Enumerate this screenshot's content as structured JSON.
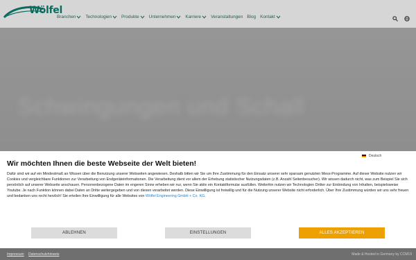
{
  "header": {
    "logo_text": "Wölfel",
    "nav": [
      {
        "label": "Branchen",
        "dropdown": true
      },
      {
        "label": "Technologien",
        "dropdown": true
      },
      {
        "label": "Produkte",
        "dropdown": true
      },
      {
        "label": "Unternehmen",
        "dropdown": true
      },
      {
        "label": "Karriere",
        "dropdown": true
      },
      {
        "label": "Veranstaltungen",
        "dropdown": false
      },
      {
        "label": "Blog",
        "dropdown": false
      },
      {
        "label": "Kontakt",
        "dropdown": true
      }
    ],
    "icons": [
      "search-icon",
      "globe-icon"
    ],
    "brand_color": "#0a6c5e"
  },
  "hero": {
    "blurred_text": "Schwingungen und Schall"
  },
  "consent": {
    "language": "Deutsch",
    "title": "Wir möchten Ihnen die beste Webseite der Welt bieten!",
    "body": "Dafür sind wir auf ein Mindestmaß an Wissen über die Benutzung unserer Webseiten angewiesen. Deshalb bitten wir Sie um Ihre Zustimmung für den Einsatz unserer sehr sparsam genutzten Mess-Programme. Auf dieser Website nutzen wir Cookies und vergleichbare Funktionen zur Verarbeitung von Endgeräteinformationen. Die Verarbeitung dient vor allem der Erhebung statistischer Nutzungsdaten (z.B. Anzahl Seitenbesucher). Wir wissen dadurch nicht, was zum Beispiel Sie sich persönlich auf unserer Webseite anschauen. Personenbezogene Daten im engeren Sinne erheben wir nur, wenn Sie aktiv ein Kontaktformular ausfüllen. Weiterhin nutzen wir Technologien Dritter zur Einbindung von Inhalten, beispielsweise Youtube. Je nach Funktion können dabei Daten an Dritte weitergegeben und von diesen verarbeitet werden. Diese Einwilligung ist freiwillig und für die Nutzung unserer Website nicht erforderlich. Über Ihre Zustimmung würden wir uns sehr freuen und bedanken uns recht herzlich! Sie erteilen Ihre Einwilligung für alle Websites von ",
    "company_link": "Wölfel Engineering GmbH + Co. KG",
    "body_end": ".",
    "buttons": {
      "decline": "ABLEHNEN",
      "settings": "EINSTELLUNGEN",
      "accept": "ALLES AKZEPTIEREN"
    },
    "accept_color": "#eea000"
  },
  "footer": {
    "imprint": "Impressum",
    "privacy": "Datenschutzhinweis",
    "made_by": "Made & Hosted in Germany by CCM19"
  }
}
